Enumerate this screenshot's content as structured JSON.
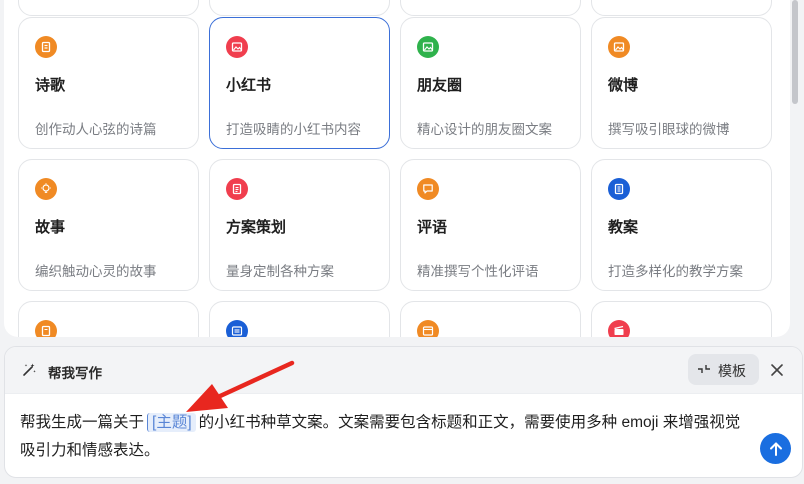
{
  "rows": [
    {
      "cards": [
        {
          "title": "",
          "desc": "",
          "icon": "doc-icon",
          "color": "#f08a24"
        },
        {
          "title": "",
          "desc": "",
          "icon": "doc-icon",
          "color": "#f08a24"
        },
        {
          "title": "",
          "desc": "",
          "icon": "doc-icon",
          "color": "#f08a24"
        },
        {
          "title": "",
          "desc": "",
          "icon": "doc-icon",
          "color": "#f08a24"
        }
      ]
    },
    {
      "cards": [
        {
          "title": "诗歌",
          "desc": "创作动人心弦的诗篇",
          "icon": "doc-icon",
          "color": "#f08a24"
        },
        {
          "title": "小红书",
          "desc": "打造吸睛的小红书内容",
          "icon": "image-icon",
          "color": "#f03e4e"
        },
        {
          "title": "朋友圈",
          "desc": "精心设计的朋友圈文案",
          "icon": "image-icon",
          "color": "#2fb24c"
        },
        {
          "title": "微博",
          "desc": "撰写吸引眼球的微博",
          "icon": "image-icon",
          "color": "#f08a24"
        }
      ]
    },
    {
      "cards": [
        {
          "title": "故事",
          "desc": "编织触动心灵的故事",
          "icon": "lightbulb-icon",
          "color": "#f08a24"
        },
        {
          "title": "方案策划",
          "desc": "量身定制各种方案",
          "icon": "clipboard-icon",
          "color": "#f03e4e"
        },
        {
          "title": "评语",
          "desc": "精准撰写个性化评语",
          "icon": "comment-icon",
          "color": "#f08a24"
        },
        {
          "title": "教案",
          "desc": "打造多样化的教学方案",
          "icon": "notebook-icon",
          "color": "#1a5fd6"
        }
      ]
    },
    {
      "cards": [
        {
          "title": "",
          "desc": "",
          "icon": "book-icon",
          "color": "#f08a24"
        },
        {
          "title": "",
          "desc": "",
          "icon": "list-icon",
          "color": "#1a5fd6"
        },
        {
          "title": "",
          "desc": "",
          "icon": "window-icon",
          "color": "#f08a24"
        },
        {
          "title": "",
          "desc": "",
          "icon": "film-icon",
          "color": "#f03e4e"
        }
      ]
    }
  ],
  "write_panel": {
    "title": "帮我写作",
    "template_label": "模板",
    "prompt_before": "帮我生成一篇关于",
    "placeholder": "[主题]",
    "prompt_after": "的小红书种草文案。文案需要包含标题和正文，需要使用多种 emoji 来增强视觉吸引力和情感表达。"
  },
  "colors": {
    "accent": "#1a6ee0",
    "selected_border": "#3b6fd8",
    "annotation_arrow": "#e8271f"
  }
}
